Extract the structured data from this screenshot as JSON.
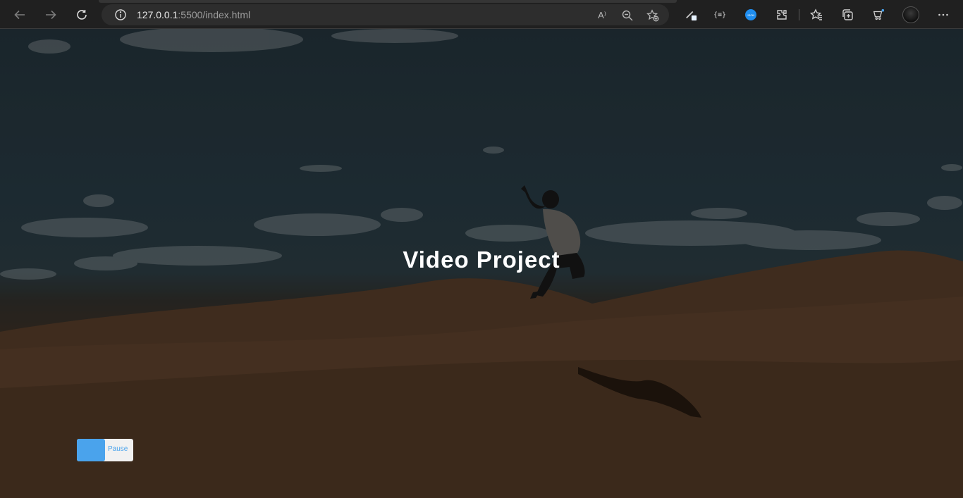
{
  "browser": {
    "url_host": "127.0.0.1",
    "url_rest": ":5500/index.html",
    "icons": [
      "back-icon",
      "forward-icon",
      "refresh-icon",
      "site-info-icon",
      "read-aloud-icon",
      "zoom-out-icon",
      "add-favorite-icon",
      "pen-extension-icon",
      "code-extension-icon",
      "json-extension-icon",
      "extensions-icon",
      "favorites-icon",
      "collections-icon",
      "browser-essentials-icon",
      "profile-avatar",
      "more-menu-icon"
    ],
    "read_aloud_glyph": "A⁾",
    "code_ext_label": "{≡}",
    "json_ext_label": "JSON"
  },
  "page": {
    "title": "Video Project",
    "toggle_label": "Pause"
  },
  "colors": {
    "accent": "#4aa3ec",
    "title": "#ffffff",
    "chrome_bg": "#202020"
  }
}
